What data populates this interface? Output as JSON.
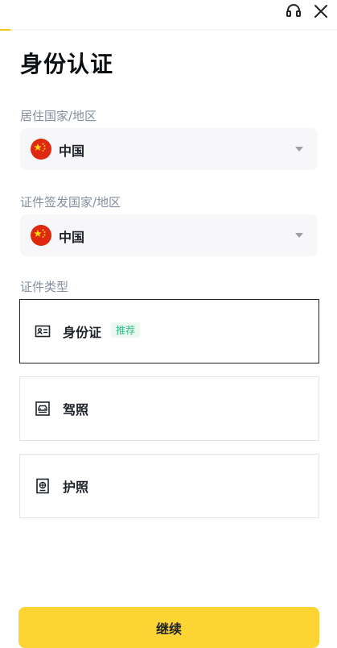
{
  "header": {
    "support_icon": "headset-icon",
    "close_icon": "close-icon",
    "progress": 0.03,
    "accent_color": "#f0c419"
  },
  "title": "身份认证",
  "residence": {
    "label": "居住国家/地区",
    "value": "中国",
    "flag": "china-flag-icon"
  },
  "issuing": {
    "label": "证件签发国家/地区",
    "value": "中国",
    "flag": "china-flag-icon"
  },
  "document_type": {
    "label": "证件类型",
    "options": [
      {
        "label": "身份证",
        "badge": "推荐",
        "icon": "id-card-icon",
        "selected": true
      },
      {
        "label": "驾照",
        "icon": "drivers-license-icon",
        "selected": false
      },
      {
        "label": "护照",
        "icon": "passport-icon",
        "selected": false
      }
    ]
  },
  "footer": {
    "continue_label": "继续",
    "button_color": "#fcd535"
  }
}
